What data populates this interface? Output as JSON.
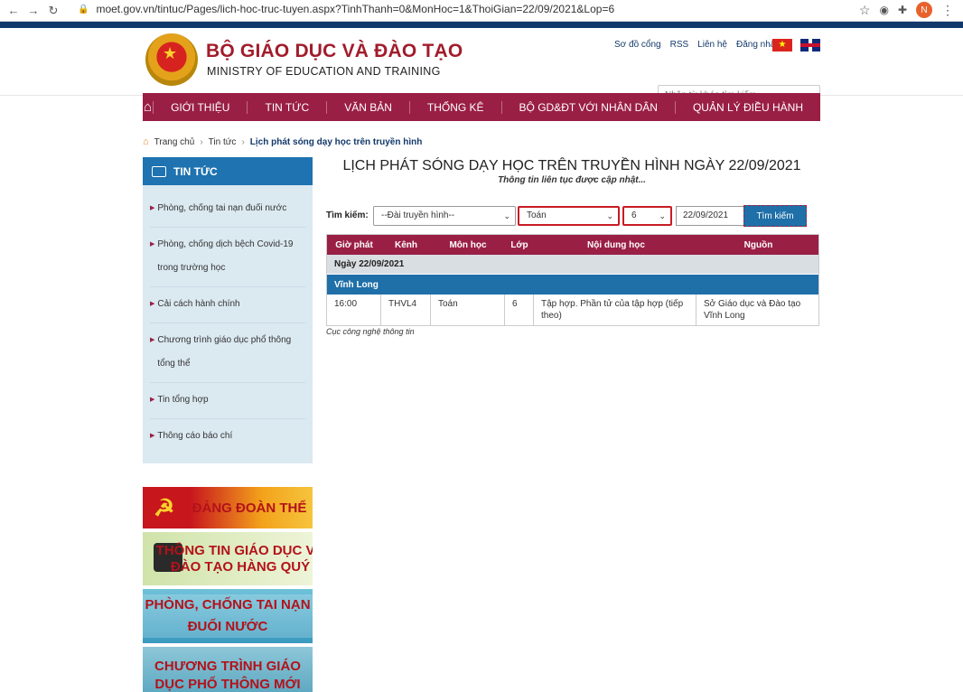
{
  "browser": {
    "url": "moet.gov.vn/tintuc/Pages/lich-hoc-truc-tuyen.aspx?TinhThanh=0&MonHoc=1&ThoiGian=22/09/2021&Lop=6",
    "avatar_letter": "N"
  },
  "header": {
    "title": "BỘ GIÁO DỤC VÀ ĐÀO TẠO",
    "subtitle": "MINISTRY OF EDUCATION AND TRAINING",
    "links": [
      "Sơ đồ cổng",
      "RSS",
      "Liên hệ",
      "Đăng nhập"
    ],
    "search_placeholder": "Nhập từ khóa tìm kiếm"
  },
  "nav": {
    "items": [
      "GIỚI THIỆU",
      "TIN TỨC",
      "VĂN BẢN",
      "THỐNG KÊ",
      "BỘ GD&ĐT VỚI NHÂN DÂN",
      "QUẢN LÝ ĐIỀU HÀNH"
    ]
  },
  "breadcrumb": [
    "Trang chủ",
    "Tin tức",
    "Lịch phát sóng dạy học trên truyền hình"
  ],
  "sidebar": {
    "heading": "TIN TỨC",
    "items": [
      "Phòng, chống tai nạn đuối nước",
      "Phòng, chống dịch bệch Covid-19 trong trường học",
      "Cải cách hành chính",
      "Chương trình giáo dục phổ thông tổng thể",
      "Tin tổng hợp",
      "Thông cáo báo chí"
    ],
    "banners": [
      "ĐẢNG ĐOÀN THỂ",
      "THÔNG TIN GIÁO DỤC VÀ ĐÀO TẠO HÀNG QUÝ",
      "PHÒNG, CHỐNG TAI NẠN ĐUỐI NƯỚC",
      "CHƯƠNG TRÌNH GIÁO DỤC PHỔ THÔNG MỚI"
    ]
  },
  "content": {
    "title": "LỊCH PHÁT SÓNG DẠY HỌC TRÊN TRUYỀN HÌNH NGÀY 22/09/2021",
    "subtitle": "Thông tin liên tục được cập nhật...",
    "search_label": "Tìm kiếm:",
    "filter_station": "--Đài truyền hình--",
    "filter_subject": "Toán",
    "filter_grade": "6",
    "filter_date": "22/09/2021",
    "search_button": "Tìm kiếm",
    "table_headers": [
      "Giờ phát",
      "Kênh",
      "Môn học",
      "Lớp",
      "Nội dung học",
      "Nguồn"
    ],
    "date_group": "Ngày 22/09/2021",
    "province": "Vĩnh Long",
    "rows": [
      {
        "time": "16:00",
        "channel": "THVL4",
        "subject": "Toán",
        "grade": "6",
        "content": "Tập hợp. Phần tử của tập hợp (tiếp theo)",
        "source": "Sở Giáo dục và Đào tạo Vĩnh Long"
      }
    ],
    "footer_note": "Cục công nghệ thông tin"
  }
}
